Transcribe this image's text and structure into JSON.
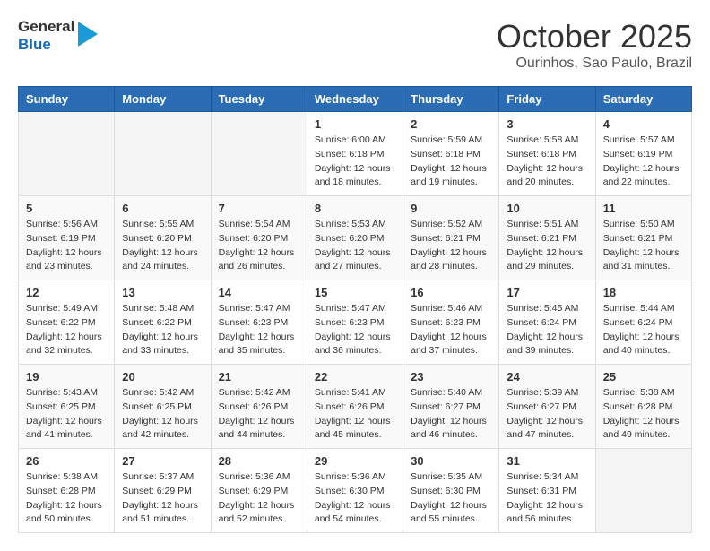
{
  "header": {
    "logo": {
      "line1": "General",
      "line2": "Blue"
    },
    "title": "October 2025",
    "location": "Ourinhos, Sao Paulo, Brazil"
  },
  "weekdays": [
    "Sunday",
    "Monday",
    "Tuesday",
    "Wednesday",
    "Thursday",
    "Friday",
    "Saturday"
  ],
  "weeks": [
    [
      {
        "day": "",
        "info": ""
      },
      {
        "day": "",
        "info": ""
      },
      {
        "day": "",
        "info": ""
      },
      {
        "day": "1",
        "info": "Sunrise: 6:00 AM\nSunset: 6:18 PM\nDaylight: 12 hours\nand 18 minutes."
      },
      {
        "day": "2",
        "info": "Sunrise: 5:59 AM\nSunset: 6:18 PM\nDaylight: 12 hours\nand 19 minutes."
      },
      {
        "day": "3",
        "info": "Sunrise: 5:58 AM\nSunset: 6:18 PM\nDaylight: 12 hours\nand 20 minutes."
      },
      {
        "day": "4",
        "info": "Sunrise: 5:57 AM\nSunset: 6:19 PM\nDaylight: 12 hours\nand 22 minutes."
      }
    ],
    [
      {
        "day": "5",
        "info": "Sunrise: 5:56 AM\nSunset: 6:19 PM\nDaylight: 12 hours\nand 23 minutes."
      },
      {
        "day": "6",
        "info": "Sunrise: 5:55 AM\nSunset: 6:20 PM\nDaylight: 12 hours\nand 24 minutes."
      },
      {
        "day": "7",
        "info": "Sunrise: 5:54 AM\nSunset: 6:20 PM\nDaylight: 12 hours\nand 26 minutes."
      },
      {
        "day": "8",
        "info": "Sunrise: 5:53 AM\nSunset: 6:20 PM\nDaylight: 12 hours\nand 27 minutes."
      },
      {
        "day": "9",
        "info": "Sunrise: 5:52 AM\nSunset: 6:21 PM\nDaylight: 12 hours\nand 28 minutes."
      },
      {
        "day": "10",
        "info": "Sunrise: 5:51 AM\nSunset: 6:21 PM\nDaylight: 12 hours\nand 29 minutes."
      },
      {
        "day": "11",
        "info": "Sunrise: 5:50 AM\nSunset: 6:21 PM\nDaylight: 12 hours\nand 31 minutes."
      }
    ],
    [
      {
        "day": "12",
        "info": "Sunrise: 5:49 AM\nSunset: 6:22 PM\nDaylight: 12 hours\nand 32 minutes."
      },
      {
        "day": "13",
        "info": "Sunrise: 5:48 AM\nSunset: 6:22 PM\nDaylight: 12 hours\nand 33 minutes."
      },
      {
        "day": "14",
        "info": "Sunrise: 5:47 AM\nSunset: 6:23 PM\nDaylight: 12 hours\nand 35 minutes."
      },
      {
        "day": "15",
        "info": "Sunrise: 5:47 AM\nSunset: 6:23 PM\nDaylight: 12 hours\nand 36 minutes."
      },
      {
        "day": "16",
        "info": "Sunrise: 5:46 AM\nSunset: 6:23 PM\nDaylight: 12 hours\nand 37 minutes."
      },
      {
        "day": "17",
        "info": "Sunrise: 5:45 AM\nSunset: 6:24 PM\nDaylight: 12 hours\nand 39 minutes."
      },
      {
        "day": "18",
        "info": "Sunrise: 5:44 AM\nSunset: 6:24 PM\nDaylight: 12 hours\nand 40 minutes."
      }
    ],
    [
      {
        "day": "19",
        "info": "Sunrise: 5:43 AM\nSunset: 6:25 PM\nDaylight: 12 hours\nand 41 minutes."
      },
      {
        "day": "20",
        "info": "Sunrise: 5:42 AM\nSunset: 6:25 PM\nDaylight: 12 hours\nand 42 minutes."
      },
      {
        "day": "21",
        "info": "Sunrise: 5:42 AM\nSunset: 6:26 PM\nDaylight: 12 hours\nand 44 minutes."
      },
      {
        "day": "22",
        "info": "Sunrise: 5:41 AM\nSunset: 6:26 PM\nDaylight: 12 hours\nand 45 minutes."
      },
      {
        "day": "23",
        "info": "Sunrise: 5:40 AM\nSunset: 6:27 PM\nDaylight: 12 hours\nand 46 minutes."
      },
      {
        "day": "24",
        "info": "Sunrise: 5:39 AM\nSunset: 6:27 PM\nDaylight: 12 hours\nand 47 minutes."
      },
      {
        "day": "25",
        "info": "Sunrise: 5:38 AM\nSunset: 6:28 PM\nDaylight: 12 hours\nand 49 minutes."
      }
    ],
    [
      {
        "day": "26",
        "info": "Sunrise: 5:38 AM\nSunset: 6:28 PM\nDaylight: 12 hours\nand 50 minutes."
      },
      {
        "day": "27",
        "info": "Sunrise: 5:37 AM\nSunset: 6:29 PM\nDaylight: 12 hours\nand 51 minutes."
      },
      {
        "day": "28",
        "info": "Sunrise: 5:36 AM\nSunset: 6:29 PM\nDaylight: 12 hours\nand 52 minutes."
      },
      {
        "day": "29",
        "info": "Sunrise: 5:36 AM\nSunset: 6:30 PM\nDaylight: 12 hours\nand 54 minutes."
      },
      {
        "day": "30",
        "info": "Sunrise: 5:35 AM\nSunset: 6:30 PM\nDaylight: 12 hours\nand 55 minutes."
      },
      {
        "day": "31",
        "info": "Sunrise: 5:34 AM\nSunset: 6:31 PM\nDaylight: 12 hours\nand 56 minutes."
      },
      {
        "day": "",
        "info": ""
      }
    ]
  ]
}
